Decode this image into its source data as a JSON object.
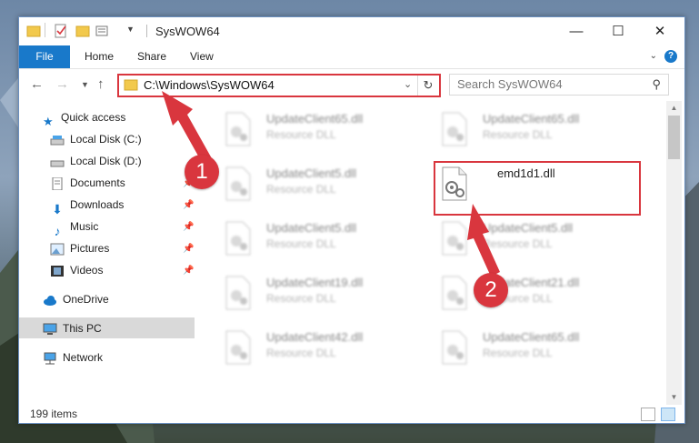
{
  "window": {
    "title": "SysWOW64",
    "minimize": "—",
    "maximize": "☐",
    "close": "✕"
  },
  "ribbon": {
    "tabs": [
      "File",
      "Home",
      "Share",
      "View"
    ],
    "help": "?"
  },
  "nav": {
    "address": "C:\\Windows\\SysWOW64",
    "search_placeholder": "Search SysWOW64"
  },
  "sidebar": {
    "items": [
      {
        "label": "Quick access",
        "icon": "star-icon"
      },
      {
        "label": "Local Disk (C:)",
        "icon": "drive-icon"
      },
      {
        "label": "Local Disk (D:)",
        "icon": "drive-icon"
      },
      {
        "label": "Documents",
        "icon": "documents-icon"
      },
      {
        "label": "Downloads",
        "icon": "downloads-icon"
      },
      {
        "label": "Music",
        "icon": "music-icon"
      },
      {
        "label": "Pictures",
        "icon": "pictures-icon"
      },
      {
        "label": "Videos",
        "icon": "videos-icon"
      },
      {
        "label": "OneDrive",
        "icon": "cloud-icon"
      },
      {
        "label": "This PC",
        "icon": "computer-icon"
      },
      {
        "label": "Network",
        "icon": "network-icon"
      }
    ]
  },
  "files": [
    {
      "name": "UpdateClient65.dll",
      "type": "Resource DLL"
    },
    {
      "name": "UpdateClient65.dll",
      "type": "Resource DLL"
    },
    {
      "name": "UpdateClient5.dll",
      "type": "Resource DLL"
    },
    {
      "name": "emd1d1.dll",
      "type": ""
    },
    {
      "name": "UpdateClient5.dll",
      "type": "Resource DLL"
    },
    {
      "name": "UpdateClient5.dll",
      "type": "Resource DLL"
    },
    {
      "name": "UpdateClient19.dll",
      "type": "Resource DLL"
    },
    {
      "name": "UpdateClient21.dll",
      "type": "Resource DLL"
    },
    {
      "name": "UpdateClient42.dll",
      "type": "Resource DLL"
    },
    {
      "name": "UpdateClient65.dll",
      "type": "Resource DLL"
    }
  ],
  "status": {
    "count": "199 items"
  },
  "annotations": {
    "step1": "1",
    "step2": "2"
  },
  "colors": {
    "accent": "#1979ca",
    "highlight": "#d9363e"
  }
}
